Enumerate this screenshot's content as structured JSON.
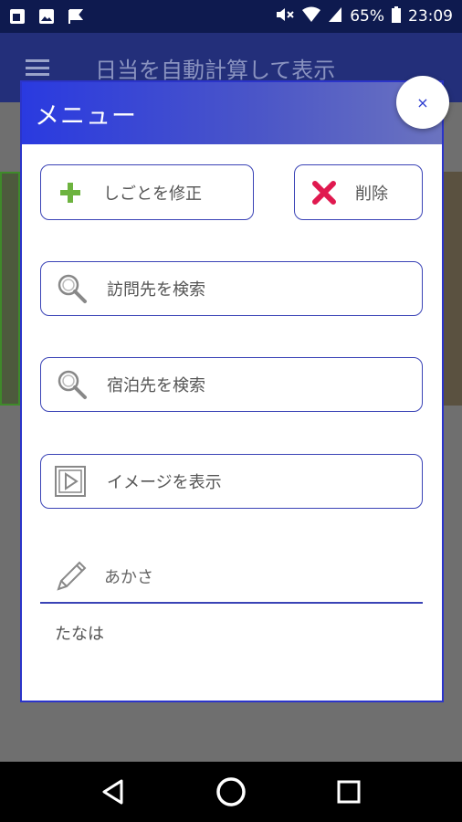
{
  "status_bar": {
    "battery": "65%",
    "time": "23:09"
  },
  "app_bar": {
    "title": "日当を自動計算して表示"
  },
  "dialog": {
    "title": "メニュー",
    "close_label": "×",
    "edit_label": "しごとを修正",
    "delete_label": "削除",
    "visit_search_label": "訪問先を検索",
    "stay_search_label": "宿泊先を検索",
    "image_label": "イメージを表示",
    "memo_label": "あかさ",
    "memo_text": "たなは"
  },
  "colors": {
    "accent": "#2b34c9",
    "edit_icon": "#6db33f",
    "delete_icon": "#e0194f"
  }
}
